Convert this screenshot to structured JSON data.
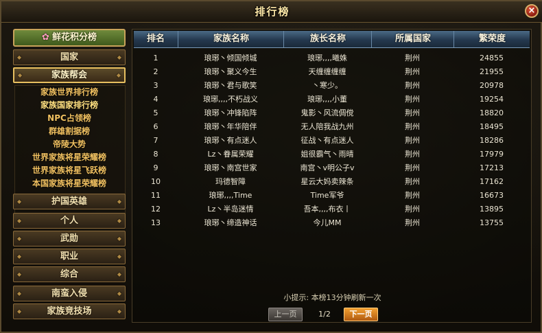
{
  "window": {
    "title": "排行榜",
    "close_icon": "×"
  },
  "sidebar": {
    "top_item": {
      "label": "鲜花积分榜",
      "icon": "flower-icon"
    },
    "buttons_top": [
      {
        "label": "国家"
      },
      {
        "label": "家族帮会",
        "active": true
      }
    ],
    "sub_items": [
      {
        "label": "家族世界排行榜"
      },
      {
        "label": "家族国家排行榜",
        "active": true
      },
      {
        "label": "NPC占领榜"
      },
      {
        "label": "群雄割据榜"
      },
      {
        "label": "帝陵大势"
      },
      {
        "label": "世界家族将星荣耀榜"
      },
      {
        "label": "世界家族将星飞跃榜"
      },
      {
        "label": "本国家族将星荣耀榜"
      }
    ],
    "buttons_bottom": [
      {
        "label": "护国英雄"
      },
      {
        "label": "个人"
      },
      {
        "label": "武勋"
      },
      {
        "label": "职业"
      },
      {
        "label": "综合"
      },
      {
        "label": "南蛮入侵"
      },
      {
        "label": "家族竞技场"
      }
    ]
  },
  "table": {
    "columns": [
      "排名",
      "家族名称",
      "族长名称",
      "所属国家",
      "繁荣度"
    ],
    "rows": [
      [
        "1",
        "琅琊丶倾国倾城",
        "琅琊,,,,曦姝",
        "荆州",
        "24855"
      ],
      [
        "2",
        "琅琊丶聚义今生",
        "天缠缠缠缠",
        "荆州",
        "21955"
      ],
      [
        "3",
        "琅琊丶君与歌笑",
        "丶寒少。",
        "荆州",
        "20978"
      ],
      [
        "4",
        "琅琊,,,,不朽战义",
        "琅琊,,,,小董",
        "荆州",
        "19254"
      ],
      [
        "5",
        "琅琊丶冲锋陷阵",
        "鬼影丶风流倜傥",
        "荆州",
        "18820"
      ],
      [
        "6",
        "琅琊丶年华陪伴",
        "无人陪我战九州",
        "荆州",
        "18495"
      ],
      [
        "7",
        "琅琊丶有点迷人",
        "征战丶有点迷人",
        "荆州",
        "18286"
      ],
      [
        "8",
        "Lz丶眷属荣耀",
        "姐很霸气丶雨晴",
        "荆州",
        "17979"
      ],
      [
        "9",
        "琅琊丶南宫世家",
        "南宫丶v明公子v",
        "荆州",
        "17213"
      ],
      [
        "10",
        "玛德智障",
        "星云大妈卖辣条",
        "荆州",
        "17162"
      ],
      [
        "11",
        "琅琊,,,,Time",
        "Time军爷",
        "荆州",
        "16673"
      ],
      [
        "12",
        "Lz丶半岛迷情",
        "吾本,,,,布衣丨",
        "荆州",
        "13895"
      ],
      [
        "13",
        "琅琊丶缔造神话",
        "今儿MM",
        "荆州",
        "13755"
      ]
    ]
  },
  "footer": {
    "tip": "小提示: 本榜13分钟刷新一次",
    "prev_label": "上一页",
    "page_info": "1/2",
    "next_label": "下一页"
  },
  "colors": {
    "header_blue": "#24384e",
    "gold": "#e8c060",
    "next_orange": "#f2a030"
  }
}
